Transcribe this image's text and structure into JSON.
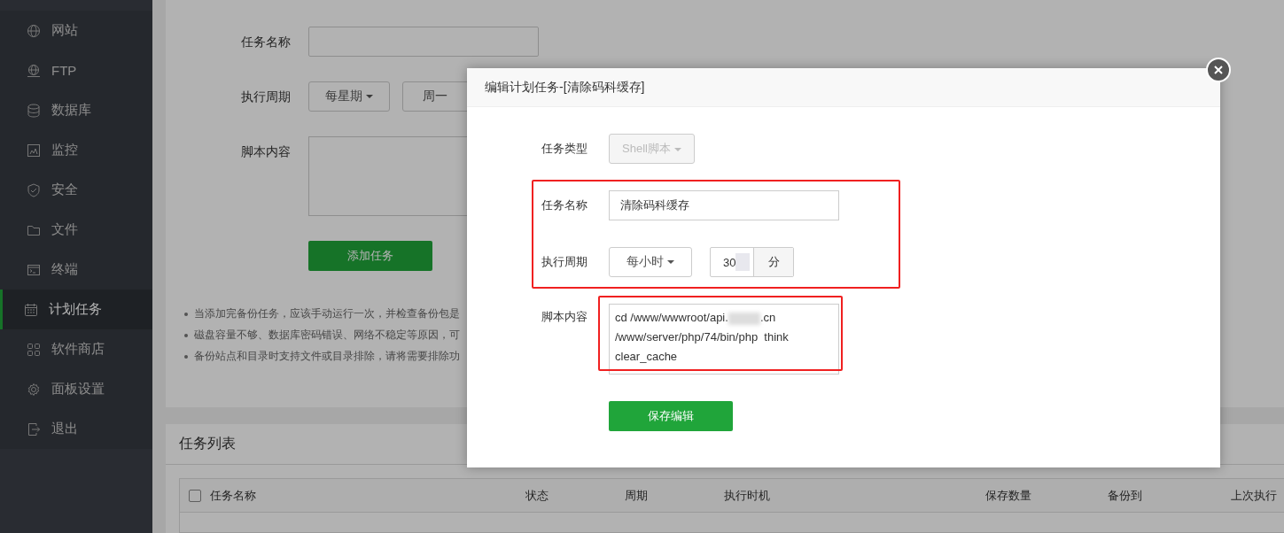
{
  "sidebar": {
    "items": [
      {
        "label": "网站",
        "selected": false
      },
      {
        "label": "FTP",
        "selected": false
      },
      {
        "label": "数据库",
        "selected": false
      },
      {
        "label": "监控",
        "selected": false
      },
      {
        "label": "安全",
        "selected": false
      },
      {
        "label": "文件",
        "selected": false
      },
      {
        "label": "终端",
        "selected": false
      },
      {
        "label": "计划任务",
        "selected": true
      },
      {
        "label": "软件商店",
        "selected": false
      },
      {
        "label": "面板设置",
        "selected": false
      },
      {
        "label": "退出",
        "selected": false
      }
    ]
  },
  "add_form": {
    "name_label": "任务名称",
    "period_label": "执行周期",
    "period_type": "每星期",
    "period_day": "周一",
    "script_label": "脚本内容",
    "submit": "添加任务",
    "hints": [
      "当添加完备份任务，应该手动运行一次，并检查备份包是",
      "磁盘容量不够、数据库密码错误、网络不稳定等原因，可",
      "备份站点和目录时支持文件或目录排除，请将需要排除功"
    ]
  },
  "task_list": {
    "title": "任务列表",
    "columns": [
      "任务名称",
      "状态",
      "周期",
      "执行时机",
      "保存数量",
      "备份到",
      "上次执行"
    ],
    "header_checked": false
  },
  "dialog": {
    "title": "编辑计划任务-[清除码科缓存]",
    "type_label": "任务类型",
    "type_value": "Shell脚本",
    "type_disabled": true,
    "name_label": "任务名称",
    "name_value": "清除码科缓存",
    "period_label": "执行周期",
    "period_type": "每小时",
    "minute_value": "30",
    "minute_unit": "分",
    "script_label": "脚本内容",
    "script_lines": [
      {
        "text": "cd /www/wwwroot/api.",
        "redacted": true,
        "rest": ".cn"
      },
      {
        "text": "/www/server/php/74/bin/php  think",
        "redacted": false
      },
      {
        "text": "clear_cache",
        "redacted": false
      }
    ],
    "save": "保存编辑"
  }
}
